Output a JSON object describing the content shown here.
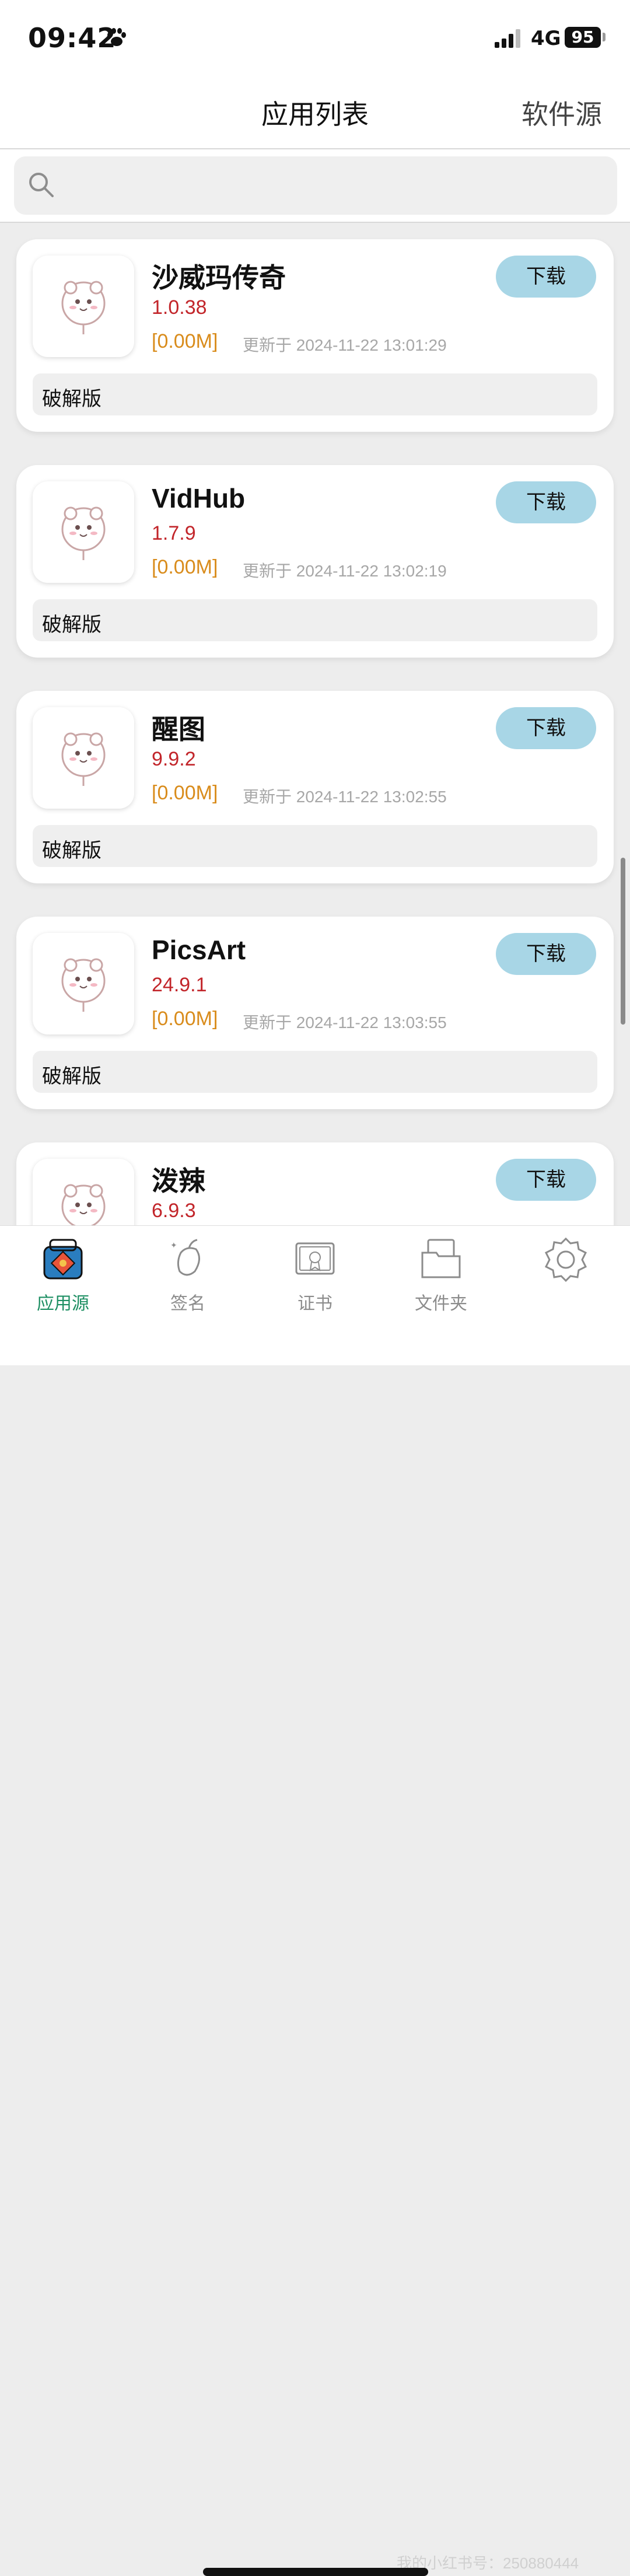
{
  "status_bar": {
    "time": "09:42",
    "network": "4G",
    "battery": "95"
  },
  "nav": {
    "title": "应用列表",
    "right_button": "软件源"
  },
  "search": {
    "placeholder": ""
  },
  "apps": [
    {
      "name": "沙威玛传奇",
      "version": "1.0.38",
      "size": "[0.00M]",
      "updated": "更新于 2024-11-22 13:01:29",
      "download_label": "下载",
      "tag": "破解版"
    },
    {
      "name": "VidHub",
      "version": "1.7.9",
      "size": "[0.00M]",
      "updated": "更新于 2024-11-22 13:02:19",
      "download_label": "下载",
      "tag": "破解版"
    },
    {
      "name": "醒图",
      "version": "9.9.2",
      "size": "[0.00M]",
      "updated": "更新于 2024-11-22 13:02:55",
      "download_label": "下载",
      "tag": "破解版"
    },
    {
      "name": "PicsArt",
      "version": "24.9.1",
      "size": "[0.00M]",
      "updated": "更新于 2024-11-22 13:03:55",
      "download_label": "下载",
      "tag": "破解版"
    },
    {
      "name": "泼辣",
      "version": "6.9.3",
      "size": "",
      "updated": "",
      "download_label": "下载",
      "tag": ""
    }
  ],
  "tabs": [
    {
      "label": "应用源",
      "icon": "app-source-icon",
      "active": true
    },
    {
      "label": "签名",
      "icon": "sign-icon",
      "active": false
    },
    {
      "label": "证书",
      "icon": "certificate-icon",
      "active": false
    },
    {
      "label": "文件夹",
      "icon": "folder-icon",
      "active": false
    },
    {
      "label": "",
      "icon": "settings-icon",
      "active": false
    }
  ],
  "watermark": "我的小红书号：250880444",
  "colors": {
    "accent_green": "#1e8f63",
    "version_red": "#c2252a",
    "size_orange": "#d98c1c",
    "download_button": "#a8d6e6"
  }
}
